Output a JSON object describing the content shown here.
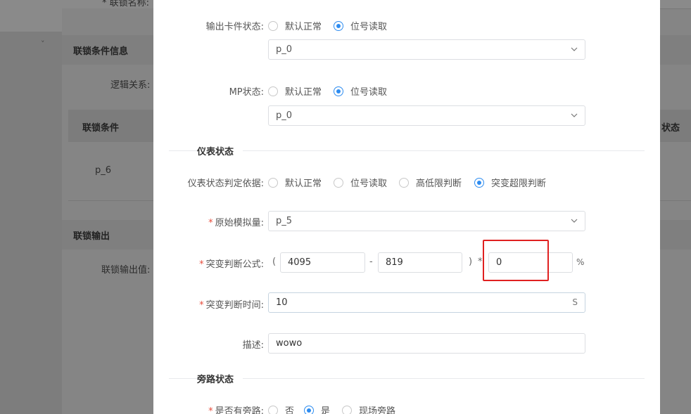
{
  "background": {
    "top_cut_label": "* 联锁名称:",
    "section_condition_info": "联锁条件信息",
    "logic_relation_label": "逻辑关系:",
    "table_header_condition": "联锁条件",
    "table_header_status": "状态",
    "condition_row_value": "p_6",
    "section_output": "联锁输出",
    "output_value_label": "联锁输出值:"
  },
  "modal": {
    "output_card": {
      "label": "输出卡件状态:",
      "options": [
        "默认正常",
        "位号读取"
      ],
      "selected": 1,
      "select_value": "p_0"
    },
    "mp": {
      "label": "MP状态:",
      "options": [
        "默认正常",
        "位号读取"
      ],
      "selected": 1,
      "select_value": "p_0"
    },
    "instrument_section": {
      "title": "仪表状态",
      "basis_label": "仪表状态判定依据:",
      "basis_options": [
        "默认正常",
        "位号读取",
        "高低限判断",
        "突变超限判断"
      ],
      "basis_selected": 3,
      "raw_analog": {
        "label": "原始模拟量:",
        "value": "p_5"
      },
      "formula": {
        "label": "突变判断公式:",
        "open_paren": "(",
        "value_a": "4095",
        "minus": "-",
        "value_b": "819",
        "close_paren": ")",
        "times": "*",
        "value_c": "0",
        "unit": "%"
      },
      "time": {
        "label": "突变判断时间:",
        "value": "10",
        "unit": "S"
      },
      "desc": {
        "label": "描述:",
        "value": "wowo"
      }
    },
    "bypass_section": {
      "title": "旁路状态",
      "has_bypass_label": "是否有旁路:",
      "options": [
        "否",
        "是",
        "现场旁路"
      ],
      "selected": 1
    }
  },
  "colors": {
    "accent": "#2d8cf0",
    "required": "#e74c3c",
    "highlight": "#e02020"
  }
}
